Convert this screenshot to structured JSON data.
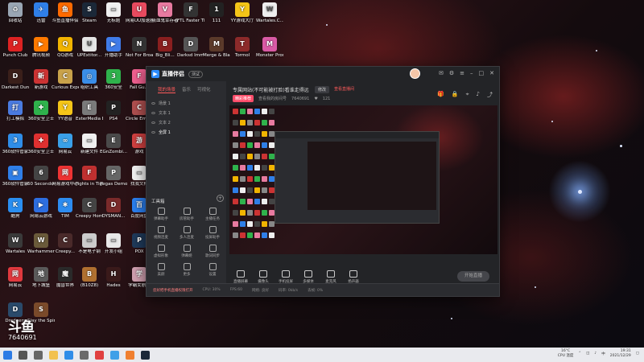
{
  "desktop_icons": [
    {
      "label": "回收站",
      "color": "#9aa6b4",
      "glyph": "♻"
    },
    {
      "label": "迅雷",
      "color": "#2f7fe8",
      "glyph": "✈"
    },
    {
      "label": "斗鱼直播伴侣",
      "color": "#ff6a00",
      "glyph": "鱼"
    },
    {
      "label": "Steam",
      "color": "#1b2838",
      "glyph": "S"
    },
    {
      "label": "无标题",
      "color": "#f0f0f0",
      "glyph": "▭"
    },
    {
      "label": "网易UU加速器",
      "color": "#e84a5f",
      "glyph": "U"
    },
    {
      "label": "吸血鬼幸存者",
      "color": "#e87aa0",
      "glyph": "V"
    },
    {
      "label": "FTL Faster Than Light",
      "color": "#333",
      "glyph": "F"
    },
    {
      "label": "111",
      "color": "#222",
      "glyph": "1"
    },
    {
      "label": "YY游戏大厅",
      "color": "#f5c518",
      "glyph": "Y"
    },
    {
      "label": "Wartales.C...",
      "color": "#eeeeee",
      "glyph": "W"
    },
    {
      "label": "Punch Club",
      "color": "#d22",
      "glyph": "P"
    },
    {
      "label": "腾讯视频",
      "color": "#ff7a00",
      "glyph": "▶"
    },
    {
      "label": "QQ游戏",
      "color": "#f2b400",
      "glyph": "Q"
    },
    {
      "label": "UPExtitor...",
      "color": "#e5e5e5",
      "glyph": "U"
    },
    {
      "label": "开播助手",
      "color": "#3f7be8",
      "glyph": "▶"
    },
    {
      "label": "Not For Broadcast",
      "color": "#333",
      "glyph": "N"
    },
    {
      "label": "Big_Bli...",
      "color": "#8a1f1f",
      "glyph": "B"
    },
    {
      "label": "Darksd Immersio...",
      "color": "#555",
      "glyph": "D"
    },
    {
      "label": "Merge & Blade",
      "color": "#5b3a2a",
      "glyph": "M"
    },
    {
      "label": "Tormol",
      "color": "#8c2a2a",
      "glyph": "T"
    },
    {
      "label": "Monster Prom",
      "color": "#d95aa5",
      "glyph": "M"
    },
    {
      "label": "Darkest Dungeon",
      "color": "#3a1f1a",
      "glyph": "D"
    },
    {
      "label": "新游戏",
      "color": "#cc3333",
      "glyph": "新"
    },
    {
      "label": "Curious Expedition",
      "color": "#c9a24a",
      "glyph": "C"
    },
    {
      "label": "组织工具",
      "color": "#3a8ee8",
      "glyph": "◎"
    },
    {
      "label": "360安全",
      "color": "#2fb24c",
      "glyph": "3"
    },
    {
      "label": "Fall Gu...",
      "color": "#f06090",
      "glyph": "F"
    },
    {
      "label": "打工模拟",
      "color": "#4a7be0",
      "glyph": "打"
    },
    {
      "label": "360安全卫士",
      "color": "#2fb24c",
      "glyph": "✚"
    },
    {
      "label": "YY语音",
      "color": "#f5c518",
      "glyph": "Y"
    },
    {
      "label": "ExterMedia EECentral 4",
      "color": "#7a7a7a",
      "glyph": "E"
    },
    {
      "label": "PS4",
      "color": "#222",
      "glyph": "P"
    },
    {
      "label": "Circle Empire",
      "color": "#b05050",
      "glyph": "C"
    },
    {
      "label": "360软件管家",
      "color": "#2f8de8",
      "glyph": "3"
    },
    {
      "label": "360安全卫士",
      "color": "#e03030",
      "glyph": "✚"
    },
    {
      "label": "网易云",
      "color": "#3aa0e8",
      "glyph": "∞"
    },
    {
      "label": "新建文件",
      "color": "#f0f0f0",
      "glyph": "▭"
    },
    {
      "label": "EGnZombi...",
      "color": "#4a4a4a",
      "glyph": "E"
    },
    {
      "label": "游戏",
      "color": "#d24040",
      "glyph": "游"
    },
    {
      "label": "360软件管家",
      "color": "#2f7fe8",
      "glyph": "▣"
    },
    {
      "label": "60 Seconds! Reatomized",
      "color": "#444",
      "glyph": "6"
    },
    {
      "label": "网易游戏中心",
      "color": "#e33",
      "glyph": "网"
    },
    {
      "label": "Fights in Tight...",
      "color": "#c03030",
      "glyph": "F"
    },
    {
      "label": "Pegas Demo",
      "color": "#666",
      "glyph": "P"
    },
    {
      "label": "找我文档",
      "color": "#f2f2f2",
      "glyph": "▭"
    },
    {
      "label": "酷狗",
      "color": "#2a8ef0",
      "glyph": "K"
    },
    {
      "label": "网易云游戏",
      "color": "#2d6ee0",
      "glyph": "▶"
    },
    {
      "label": "TIM",
      "color": "#2d8cf0",
      "glyph": "✱"
    },
    {
      "label": "Creepy Homeline...",
      "color": "#444",
      "glyph": "C"
    },
    {
      "label": "DYSMAN...",
      "color": "#7a2a2a",
      "glyph": "D"
    },
    {
      "label": "百度网盘",
      "color": "#2a7ff0",
      "glyph": "百"
    },
    {
      "label": "Wartales",
      "color": "#3a3a3a",
      "glyph": "W"
    },
    {
      "label": "Warhammer 40,000",
      "color": "#6a5a3a",
      "glyph": "W"
    },
    {
      "label": "Creepy...",
      "color": "#4a2a2a",
      "glyph": "C"
    },
    {
      "label": "不是电子钢",
      "color": "#ccc",
      "glyph": "▭"
    },
    {
      "label": "开发小组",
      "color": "#e8e8e8",
      "glyph": "▭"
    },
    {
      "label": "POX",
      "color": "#1f3a5a",
      "glyph": "P"
    },
    {
      "label": "网易云",
      "color": "#e0393e",
      "glyph": "网"
    },
    {
      "label": "地下城堡",
      "color": "#5a5a5a",
      "glyph": "地"
    },
    {
      "label": "魔兽世界",
      "color": "#2a2a2a",
      "glyph": "魔"
    },
    {
      "label": "(B10Z8)",
      "color": "#b07030",
      "glyph": "B"
    },
    {
      "label": "Hades",
      "color": "#3a1a1a",
      "glyph": "H"
    },
    {
      "label": "学霸女剧情",
      "color": "#d0a0b0",
      "glyph": "学"
    },
    {
      "label": "Dredgers",
      "color": "#2a4a6a",
      "glyph": "D"
    },
    {
      "label": "Slay the Spire",
      "color": "#7a4a2a",
      "glyph": "S"
    }
  ],
  "app": {
    "name": "直播伴侣",
    "version_badge": "测试",
    "tabs": [
      "我的场景",
      "音乐",
      "可视化"
    ],
    "scenes": [
      "场景 1",
      "文本 1",
      "文本 2",
      "全屏 1"
    ],
    "tools_title": "工具箱",
    "tools": [
      "弹幕助手",
      "房管助手",
      "主播任务",
      "视频连麦",
      "多人连麦",
      "投屏助手",
      "虚拟形象",
      "弹幕姬",
      "歌词同步",
      "美颜",
      "更多",
      "设置"
    ],
    "room_title": "专属网站(不可能被打脸)看谁走得远",
    "room_btn": "修改",
    "room_link": "查看直播间",
    "room_meta": {
      "category": "精彩推荐",
      "room_label": "查看我的房间号",
      "room_id": "7640691",
      "fans": "121"
    },
    "bottom_bar": [
      "直播屏幕",
      "摄像头",
      "手机投屏",
      "多媒体",
      "麦克风",
      "扬声器"
    ],
    "go_live": "开始直播",
    "status": {
      "warn": "您好把手机直播权限打开",
      "cpu": "CPU: 30%",
      "fps": "FPS:60",
      "net": "网络: 良好",
      "bitrate": "码率: 0kb/s",
      "dropped": "丢帧: 0%"
    }
  },
  "watermark": {
    "logo": "斗鱼",
    "room_number": "7640691"
  },
  "taskbar": {
    "pinned": [
      {
        "name": "start",
        "color": "#2c7be5"
      },
      {
        "name": "search",
        "color": "#555"
      },
      {
        "name": "task-view",
        "color": "#666"
      },
      {
        "name": "file-explorer",
        "color": "#f2c14e"
      },
      {
        "name": "browser",
        "color": "#2f8de8"
      },
      {
        "name": "store",
        "color": "#6a6a6a"
      },
      {
        "name": "app1",
        "color": "#e04040"
      },
      {
        "name": "app2",
        "color": "#3fa0e8"
      },
      {
        "name": "app3",
        "color": "#f08030"
      },
      {
        "name": "steam",
        "color": "#1b2838"
      }
    ],
    "cpu_temp": "16°C",
    "cpu_label": "CPU 温度",
    "time": "19:31",
    "date": "2021/12/29"
  },
  "colors": {
    "accent": "#ff5a5a",
    "window_bg": "#2b2c30",
    "taskbar_bg": "#e9eaee"
  }
}
